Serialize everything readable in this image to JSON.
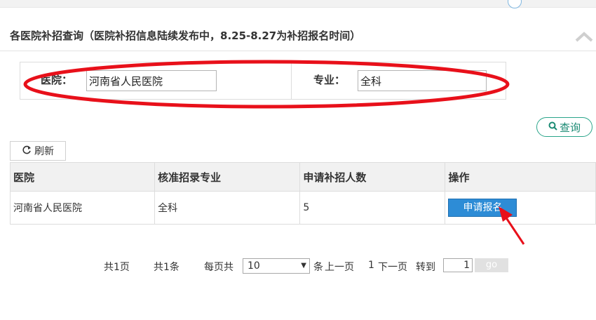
{
  "panel": {
    "title": "各医院补招查询（医院补招信息陆续发布中，8.25-8.27为补招报名时间）"
  },
  "filters": {
    "hospital_label": "医院：",
    "hospital_value": "河南省人民医院",
    "major_label": "专业：",
    "major_value": "全科",
    "query_label": "查询"
  },
  "toolbar": {
    "refresh_label": "刷新"
  },
  "table": {
    "headers": [
      "医院",
      "核准招录专业",
      "申请补招人数",
      "操作"
    ],
    "rows": [
      {
        "hospital": "河南省人民医院",
        "major": "全科",
        "count": "5",
        "action": "申请报名"
      }
    ]
  },
  "pager": {
    "total_pages": "共1页",
    "total_items": "共1条",
    "per_page_label": "每页共",
    "per_page_value": "10",
    "items_suffix": "条",
    "prev": "上一页",
    "current_page": "1",
    "next": "下一页",
    "goto_label": "转到",
    "goto_value": "1",
    "go_label": "go"
  },
  "colors": {
    "annotation_red": "#e8101a",
    "apply_button": "#2d8cd6",
    "query_border": "#2aa58a"
  }
}
